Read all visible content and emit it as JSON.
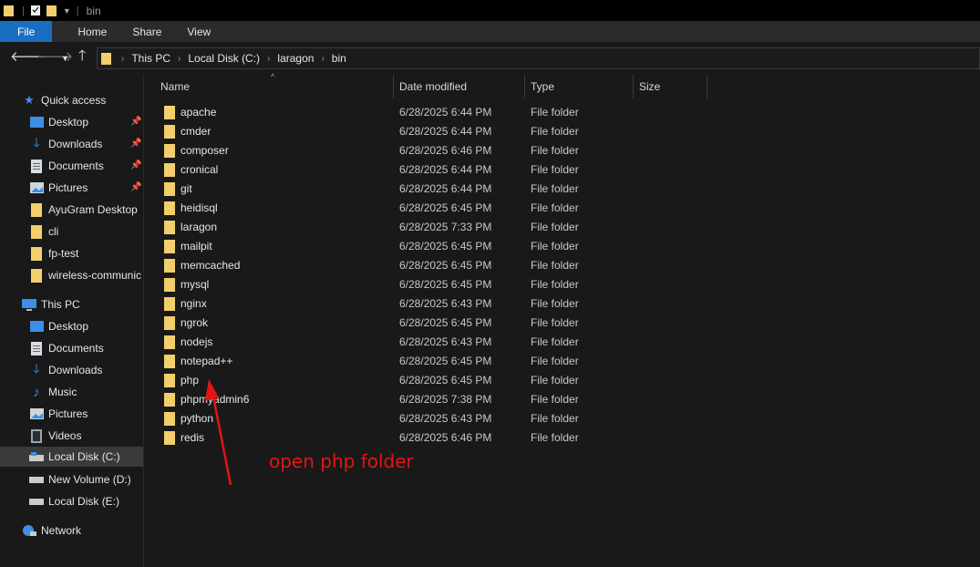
{
  "window": {
    "title": "bin"
  },
  "ribbon": {
    "tabs": [
      "File",
      "Home",
      "Share",
      "View"
    ]
  },
  "address": {
    "crumbs": [
      "This PC",
      "Local Disk (C:)",
      "laragon",
      "bin"
    ]
  },
  "sidebar": {
    "quick_access": "Quick access",
    "quick_items": [
      "Desktop",
      "Downloads",
      "Documents",
      "Pictures",
      "AyuGram Desktop",
      "cli",
      "fp-test",
      "wireless-communic"
    ],
    "this_pc": "This PC",
    "pc_items": [
      "Desktop",
      "Documents",
      "Downloads",
      "Music",
      "Pictures",
      "Videos",
      "Local Disk (C:)",
      "New Volume (D:)",
      "Local Disk (E:)"
    ],
    "network": "Network"
  },
  "columns": {
    "name": "Name",
    "date": "Date modified",
    "type": "Type",
    "size": "Size"
  },
  "files": [
    {
      "name": "apache",
      "date": "6/28/2025 6:44 PM",
      "type": "File folder"
    },
    {
      "name": "cmder",
      "date": "6/28/2025 6:44 PM",
      "type": "File folder"
    },
    {
      "name": "composer",
      "date": "6/28/2025 6:46 PM",
      "type": "File folder"
    },
    {
      "name": "cronical",
      "date": "6/28/2025 6:44 PM",
      "type": "File folder"
    },
    {
      "name": "git",
      "date": "6/28/2025 6:44 PM",
      "type": "File folder"
    },
    {
      "name": "heidisql",
      "date": "6/28/2025 6:45 PM",
      "type": "File folder"
    },
    {
      "name": "laragon",
      "date": "6/28/2025 7:33 PM",
      "type": "File folder"
    },
    {
      "name": "mailpit",
      "date": "6/28/2025 6:45 PM",
      "type": "File folder"
    },
    {
      "name": "memcached",
      "date": "6/28/2025 6:45 PM",
      "type": "File folder"
    },
    {
      "name": "mysql",
      "date": "6/28/2025 6:45 PM",
      "type": "File folder"
    },
    {
      "name": "nginx",
      "date": "6/28/2025 6:43 PM",
      "type": "File folder"
    },
    {
      "name": "ngrok",
      "date": "6/28/2025 6:45 PM",
      "type": "File folder"
    },
    {
      "name": "nodejs",
      "date": "6/28/2025 6:43 PM",
      "type": "File folder"
    },
    {
      "name": "notepad++",
      "date": "6/28/2025 6:45 PM",
      "type": "File folder"
    },
    {
      "name": "php",
      "date": "6/28/2025 6:45 PM",
      "type": "File folder"
    },
    {
      "name": "phpmyadmin6",
      "date": "6/28/2025 7:38 PM",
      "type": "File folder"
    },
    {
      "name": "python",
      "date": "6/28/2025 6:43 PM",
      "type": "File folder"
    },
    {
      "name": "redis",
      "date": "6/28/2025 6:46 PM",
      "type": "File folder"
    }
  ],
  "annotation": {
    "text": "open php folder",
    "color": "#e51414"
  },
  "colors": {
    "accent": "#1a6ec2",
    "folder": "#f2cf6b",
    "background": "#191919"
  }
}
